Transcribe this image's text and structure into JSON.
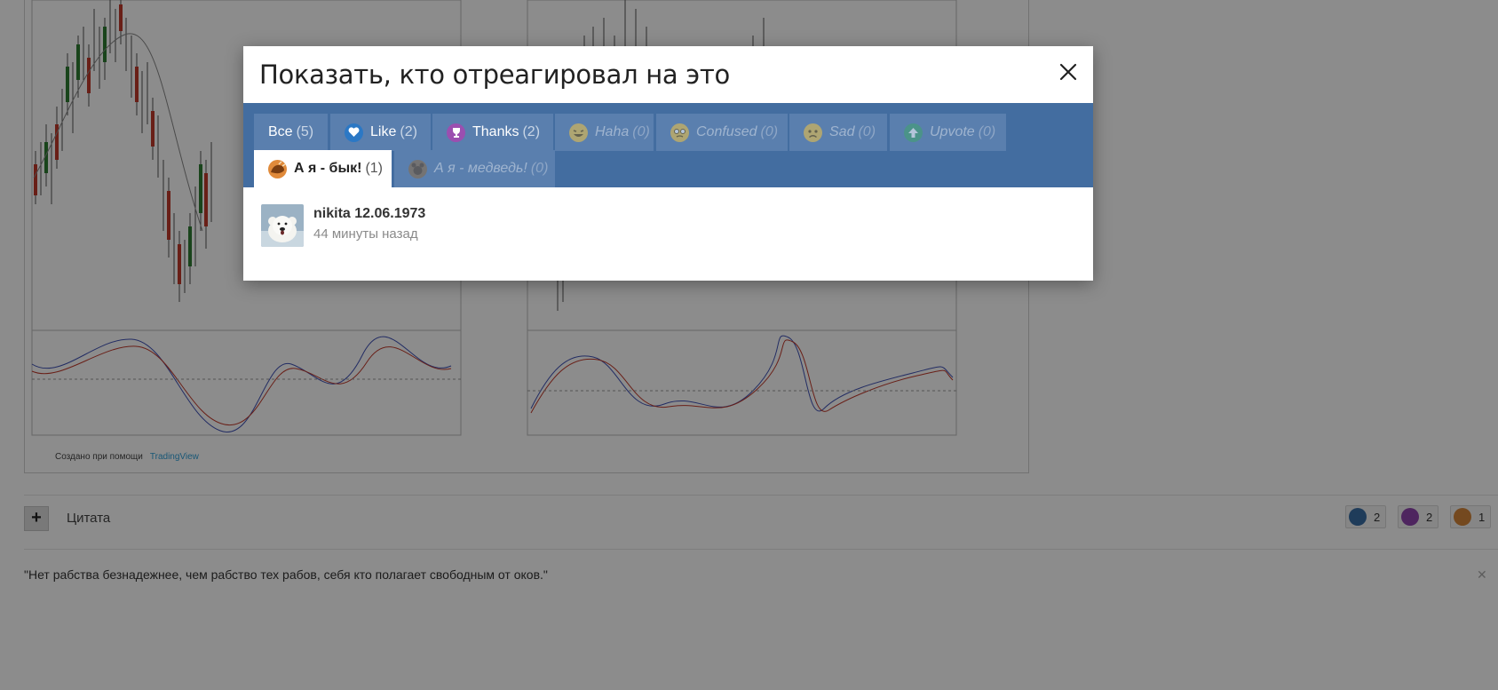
{
  "modal": {
    "title": "Показать, кто отреагировал на это",
    "tabs": [
      {
        "label": "Все",
        "count": "(5)",
        "icon": "none",
        "state": "normal"
      },
      {
        "label": "Like",
        "count": "(2)",
        "icon": "heart-icon",
        "state": "normal"
      },
      {
        "label": "Thanks",
        "count": "(2)",
        "icon": "trophy-icon",
        "state": "normal"
      },
      {
        "label": "Haha",
        "count": "(0)",
        "icon": "laugh-icon",
        "state": "dim"
      },
      {
        "label": "Confused",
        "count": "(0)",
        "icon": "confused-icon",
        "state": "dim"
      },
      {
        "label": "Sad",
        "count": "(0)",
        "icon": "sad-icon",
        "state": "dim"
      },
      {
        "label": "Upvote",
        "count": "(0)",
        "icon": "upvote-icon",
        "state": "dim"
      },
      {
        "label": "А я - бык!",
        "count": "(1)",
        "icon": "bull-icon",
        "state": "active"
      },
      {
        "label": "А я - медведь!",
        "count": "(0)",
        "icon": "bear-icon",
        "state": "dim"
      }
    ],
    "reactions": [
      {
        "user": "nikita 12.06.1973",
        "time": "44 минуты назад"
      }
    ]
  },
  "post": {
    "chart_credit": "Создано при помощи",
    "chart_credit_brand": "TradingView",
    "quote_label": "Цитата",
    "reaction_summary": [
      {
        "icon": "heart-icon",
        "count": "2"
      },
      {
        "icon": "trophy-icon",
        "count": "2"
      },
      {
        "icon": "bull-icon",
        "count": "1"
      }
    ],
    "signature": "\"Нет рабства безнадежнее, чем рабство тех рабов, себя кто полагает свободным от оков.\""
  },
  "colors": {
    "tabbar": "#436da0",
    "tab": "#5a7fae",
    "overlay": "rgba(0,0,0,0.45)"
  }
}
